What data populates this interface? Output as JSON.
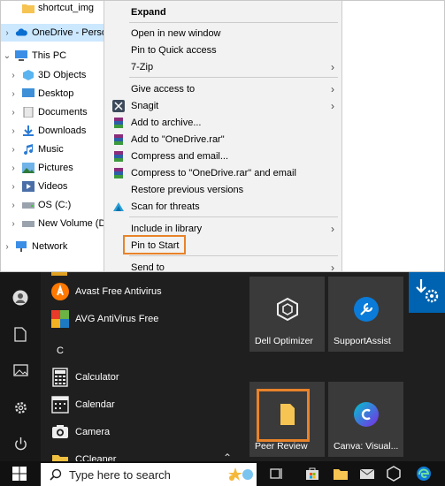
{
  "nav": {
    "items": [
      {
        "label": "shortcut_img",
        "icon": "folder-icon"
      },
      {
        "label": "OneDrive - Persor",
        "icon": "onedrive-icon"
      },
      {
        "label": "This PC",
        "icon": "computer-icon"
      },
      {
        "label": "3D Objects",
        "icon": "3d-objects-icon"
      },
      {
        "label": "Desktop",
        "icon": "desktop-folder-icon"
      },
      {
        "label": "Documents",
        "icon": "documents-icon"
      },
      {
        "label": "Downloads",
        "icon": "downloads-icon"
      },
      {
        "label": "Music",
        "icon": "music-icon"
      },
      {
        "label": "Pictures",
        "icon": "pictures-icon"
      },
      {
        "label": "Videos",
        "icon": "videos-icon"
      },
      {
        "label": "OS (C:)",
        "icon": "drive-icon"
      },
      {
        "label": "New Volume (D:",
        "icon": "drive-icon"
      },
      {
        "label": "Network",
        "icon": "network-icon"
      }
    ]
  },
  "context_menu": {
    "expand": "Expand",
    "open_new_window": "Open in new window",
    "pin_quick_access": "Pin to Quick access",
    "seven_zip": "7-Zip",
    "give_access": "Give access to",
    "snagit": "Snagit",
    "add_archive": "Add to archive...",
    "add_rar": "Add to \"OneDrive.rar\"",
    "compress_email": "Compress and email...",
    "compress_rar_email": "Compress to \"OneDrive.rar\" and email",
    "restore_versions": "Restore previous versions",
    "scan_threats": "Scan for threats",
    "include_library": "Include in library",
    "pin_start": "Pin to Start",
    "send_to": "Send to"
  },
  "start_menu": {
    "apps": [
      {
        "label": "Avast Free Antivirus",
        "icon": "avast-icon"
      },
      {
        "label": "AVG AntiVirus Free",
        "icon": "avg-icon"
      },
      {
        "label": "Calculator",
        "icon": "calculator-icon"
      },
      {
        "label": "Calendar",
        "icon": "calendar-icon"
      },
      {
        "label": "Camera",
        "icon": "camera-icon"
      },
      {
        "label": "CCleaner",
        "icon": "ccleaner-icon"
      }
    ],
    "section_letter": "C",
    "tiles": {
      "dell_optimizer": "Dell Optimizer",
      "support_assist": "SupportAssist",
      "peer_review": "Peer Review",
      "canva": "Canva: Visual..."
    }
  },
  "taskbar": {
    "search_placeholder": "Type here to search"
  },
  "colors": {
    "highlight": "#e8832a",
    "selection": "#cce8ff",
    "menu_bg": "#f2f2f2",
    "start_bg": "#1f1f1f",
    "tile_bg": "#3a3a3a",
    "accent_blue": "#0063b1"
  }
}
